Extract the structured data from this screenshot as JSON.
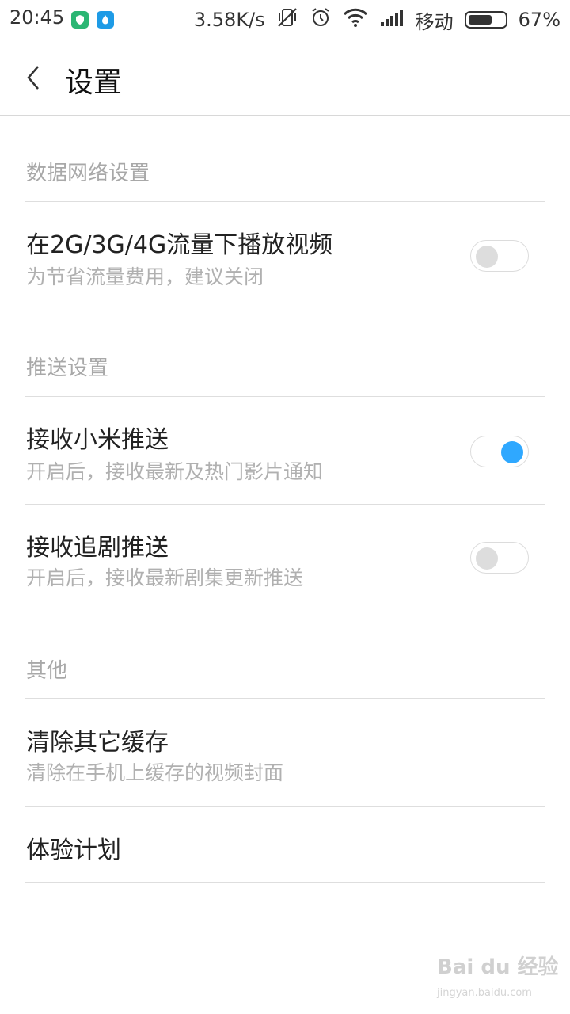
{
  "status_bar": {
    "time": "20:45",
    "network_speed": "3.58K/s",
    "carrier": "移动",
    "battery_percent": "67%",
    "battery_level": 0.67,
    "icons": [
      "shield-app-icon",
      "water-app-icon",
      "vibrate-off-icon",
      "alarm-icon",
      "wifi-icon",
      "signal-icon",
      "battery-icon"
    ]
  },
  "header": {
    "title": "设置",
    "back_icon": "back-arrow-icon"
  },
  "sections": [
    {
      "title": "数据网络设置",
      "items": [
        {
          "title": "在2G/3G/4G流量下播放视频",
          "subtitle": "为节省流量费用，建议关闭",
          "toggle": false
        }
      ]
    },
    {
      "title": "推送设置",
      "items": [
        {
          "title": "接收小米推送",
          "subtitle": "开启后，接收最新及热门影片通知",
          "toggle": true
        },
        {
          "title": "接收追剧推送",
          "subtitle": "开启后，接收最新剧集更新推送",
          "toggle": false
        }
      ]
    },
    {
      "title": "其他",
      "items": [
        {
          "title": "清除其它缓存",
          "subtitle": "清除在手机上缓存的视频封面"
        },
        {
          "title": "体验计划"
        }
      ]
    }
  ],
  "watermark": {
    "main": "Bai du 经验",
    "sub": "jingyan.baidu.com"
  },
  "colors": {
    "toggle_on": "#2fa8ff",
    "toggle_off_knob": "#dddddd",
    "section_text": "#a8a8a8"
  }
}
